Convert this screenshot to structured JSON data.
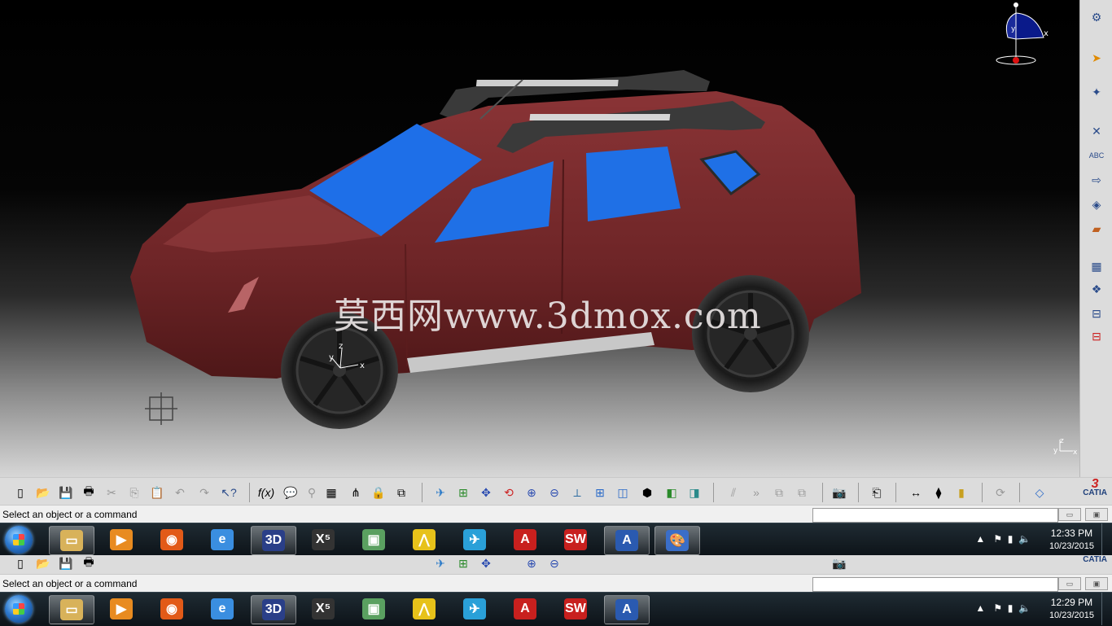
{
  "viewport": {
    "watermark": "莫西网www.3dmox.com",
    "compass": {
      "axis_x": "x",
      "axis_y": "y",
      "axis_z": "z"
    },
    "origin_axes": {
      "x": "x",
      "y": "y",
      "z": "z"
    },
    "corner_axes": {
      "x": "x",
      "y": "y",
      "z": "z"
    }
  },
  "right_toolbar": {
    "icons": [
      "gear-icon",
      "select-arrow-icon",
      "snap-icon",
      "sketch-icon",
      "text-abc-icon",
      "arrow-icon",
      "cube-icon",
      "paint-icon",
      "part-icon",
      "product-icon",
      "tree-icon",
      "tree-alt-icon"
    ]
  },
  "bottom_toolbar": {
    "icons": [
      "new-file-icon",
      "open-folder-icon",
      "save-icon",
      "print-icon",
      "cut-icon",
      "copy-icon",
      "paste-icon",
      "undo-icon",
      "redo-icon",
      "whats-this-icon",
      "formula-icon",
      "comment-icon",
      "probe-icon",
      "table-icon",
      "tree-icon",
      "lock-icon",
      "filter-icon",
      "fly-icon",
      "fit-all-icon",
      "pan-icon",
      "rotate-icon",
      "zoom-in-icon",
      "zoom-out-icon",
      "normal-view-icon",
      "multi-view-icon",
      "iso-view-icon",
      "shading-icon",
      "hide-show-icon",
      "swap-icon",
      "cut-plane-icon",
      "scroll-icon",
      "capture-icon",
      "camera-icon",
      "measure-icon",
      "apply-material-icon",
      "clip-icon",
      "update-icon",
      "eraser-icon"
    ],
    "logo": "CATIA"
  },
  "status_bar": {
    "text": "Select an object or a command",
    "input_value": ""
  },
  "taskbar_top": {
    "apps": [
      {
        "name": "explorer",
        "glyph": "▭",
        "color": "#d8b25a",
        "active": true
      },
      {
        "name": "media",
        "glyph": "▶",
        "color": "#e88b20",
        "active": false
      },
      {
        "name": "firefox",
        "glyph": "◉",
        "color": "#e25a18",
        "active": false
      },
      {
        "name": "ie",
        "glyph": "e",
        "color": "#3a8ee0",
        "active": false
      },
      {
        "name": "catia",
        "glyph": "3D",
        "color": "#2a3f88",
        "active": true
      },
      {
        "name": "x5",
        "glyph": "X⁵",
        "color": "#333",
        "active": false
      },
      {
        "name": "layout",
        "glyph": "▣",
        "color": "#5aa060",
        "active": false
      },
      {
        "name": "alias",
        "glyph": "⋀",
        "color": "#e7c21a",
        "active": false
      },
      {
        "name": "rhino",
        "glyph": "✈",
        "color": "#2aa0d8",
        "active": false
      },
      {
        "name": "acrobat",
        "glyph": "A",
        "color": "#c8201e",
        "active": false
      },
      {
        "name": "solidworks",
        "glyph": "SW",
        "color": "#c8201e",
        "active": false
      },
      {
        "name": "catia-a",
        "glyph": "A",
        "color": "#2a5ab0",
        "active": true
      },
      {
        "name": "paint",
        "glyph": "🎨",
        "color": "#3a6ec8",
        "active": true
      }
    ],
    "time": "12:33 PM",
    "date": "10/23/2015"
  },
  "taskbar_bottom": {
    "apps": [
      {
        "name": "explorer",
        "glyph": "▭",
        "color": "#d8b25a",
        "active": true
      },
      {
        "name": "media",
        "glyph": "▶",
        "color": "#e88b20",
        "active": false
      },
      {
        "name": "firefox",
        "glyph": "◉",
        "color": "#e25a18",
        "active": false
      },
      {
        "name": "ie",
        "glyph": "e",
        "color": "#3a8ee0",
        "active": false
      },
      {
        "name": "catia",
        "glyph": "3D",
        "color": "#2a3f88",
        "active": true
      },
      {
        "name": "x5",
        "glyph": "X⁵",
        "color": "#333",
        "active": false
      },
      {
        "name": "layout",
        "glyph": "▣",
        "color": "#5aa060",
        "active": false
      },
      {
        "name": "alias",
        "glyph": "⋀",
        "color": "#e7c21a",
        "active": false
      },
      {
        "name": "rhino",
        "glyph": "✈",
        "color": "#2aa0d8",
        "active": false
      },
      {
        "name": "acrobat",
        "glyph": "A",
        "color": "#c8201e",
        "active": false
      },
      {
        "name": "solidworks",
        "glyph": "SW",
        "color": "#c8201e",
        "active": false
      },
      {
        "name": "catia-a",
        "glyph": "A",
        "color": "#2a5ab0",
        "active": true
      }
    ],
    "time": "12:29 PM",
    "date": "10/23/2015"
  },
  "colors": {
    "car_body": "#7a2a2c",
    "glass": "#1e6fe8",
    "tire": "#222222",
    "roof_rail": "#3a3a3a",
    "side_step": "#c8c8c8"
  }
}
